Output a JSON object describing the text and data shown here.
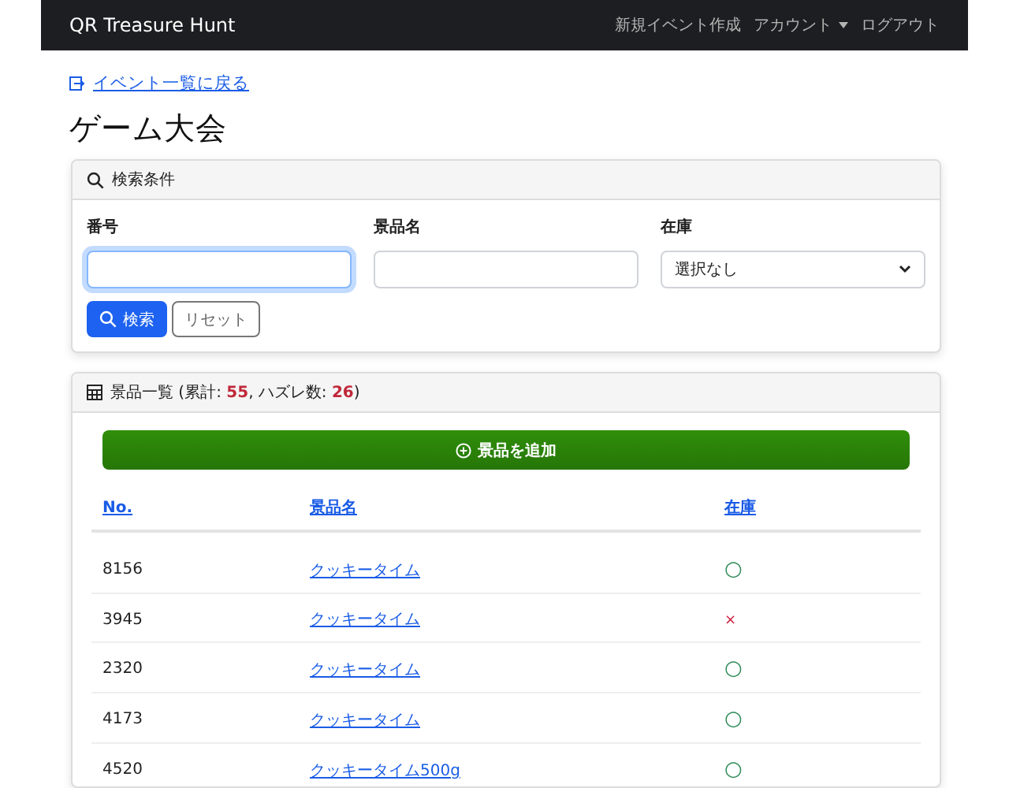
{
  "navbar": {
    "brand": "QR Treasure Hunt",
    "links": [
      {
        "label": "新規イベント作成",
        "dropdown": false
      },
      {
        "label": "アカウント",
        "dropdown": true
      },
      {
        "label": "ログアウト",
        "dropdown": false
      }
    ]
  },
  "back_link": "イベント一覧に戻る",
  "title": "ゲーム大会",
  "search": {
    "header": "検索条件",
    "fields": [
      {
        "kind": "text",
        "label": "番号",
        "focused": true
      },
      {
        "kind": "text",
        "label": "景品名",
        "focused": false
      },
      {
        "kind": "select",
        "label": "在庫",
        "value": "選択なし",
        "focused": false
      }
    ],
    "search_button": "検索",
    "reset_button": "リセット"
  },
  "prizes": {
    "header": "景品一覧 (累計: **55**, ハズレ数: **26**)",
    "add_button": "景品を追加",
    "columns": [
      "No.",
      "景品名",
      "在庫"
    ],
    "rows": [
      {
        "number": "8156",
        "name": "クッキータイム",
        "stock": "○",
        "in_stock": true
      },
      {
        "number": "3945",
        "name": "クッキータイム",
        "stock": "×",
        "in_stock": false
      },
      {
        "number": "2320",
        "name": "クッキータイム",
        "stock": "○",
        "in_stock": true
      },
      {
        "number": "4173",
        "name": "クッキータイム",
        "stock": "○",
        "in_stock": true
      },
      {
        "number": "4520",
        "name": "クッキータイム500g",
        "stock": "○",
        "in_stock": true
      }
    ]
  }
}
